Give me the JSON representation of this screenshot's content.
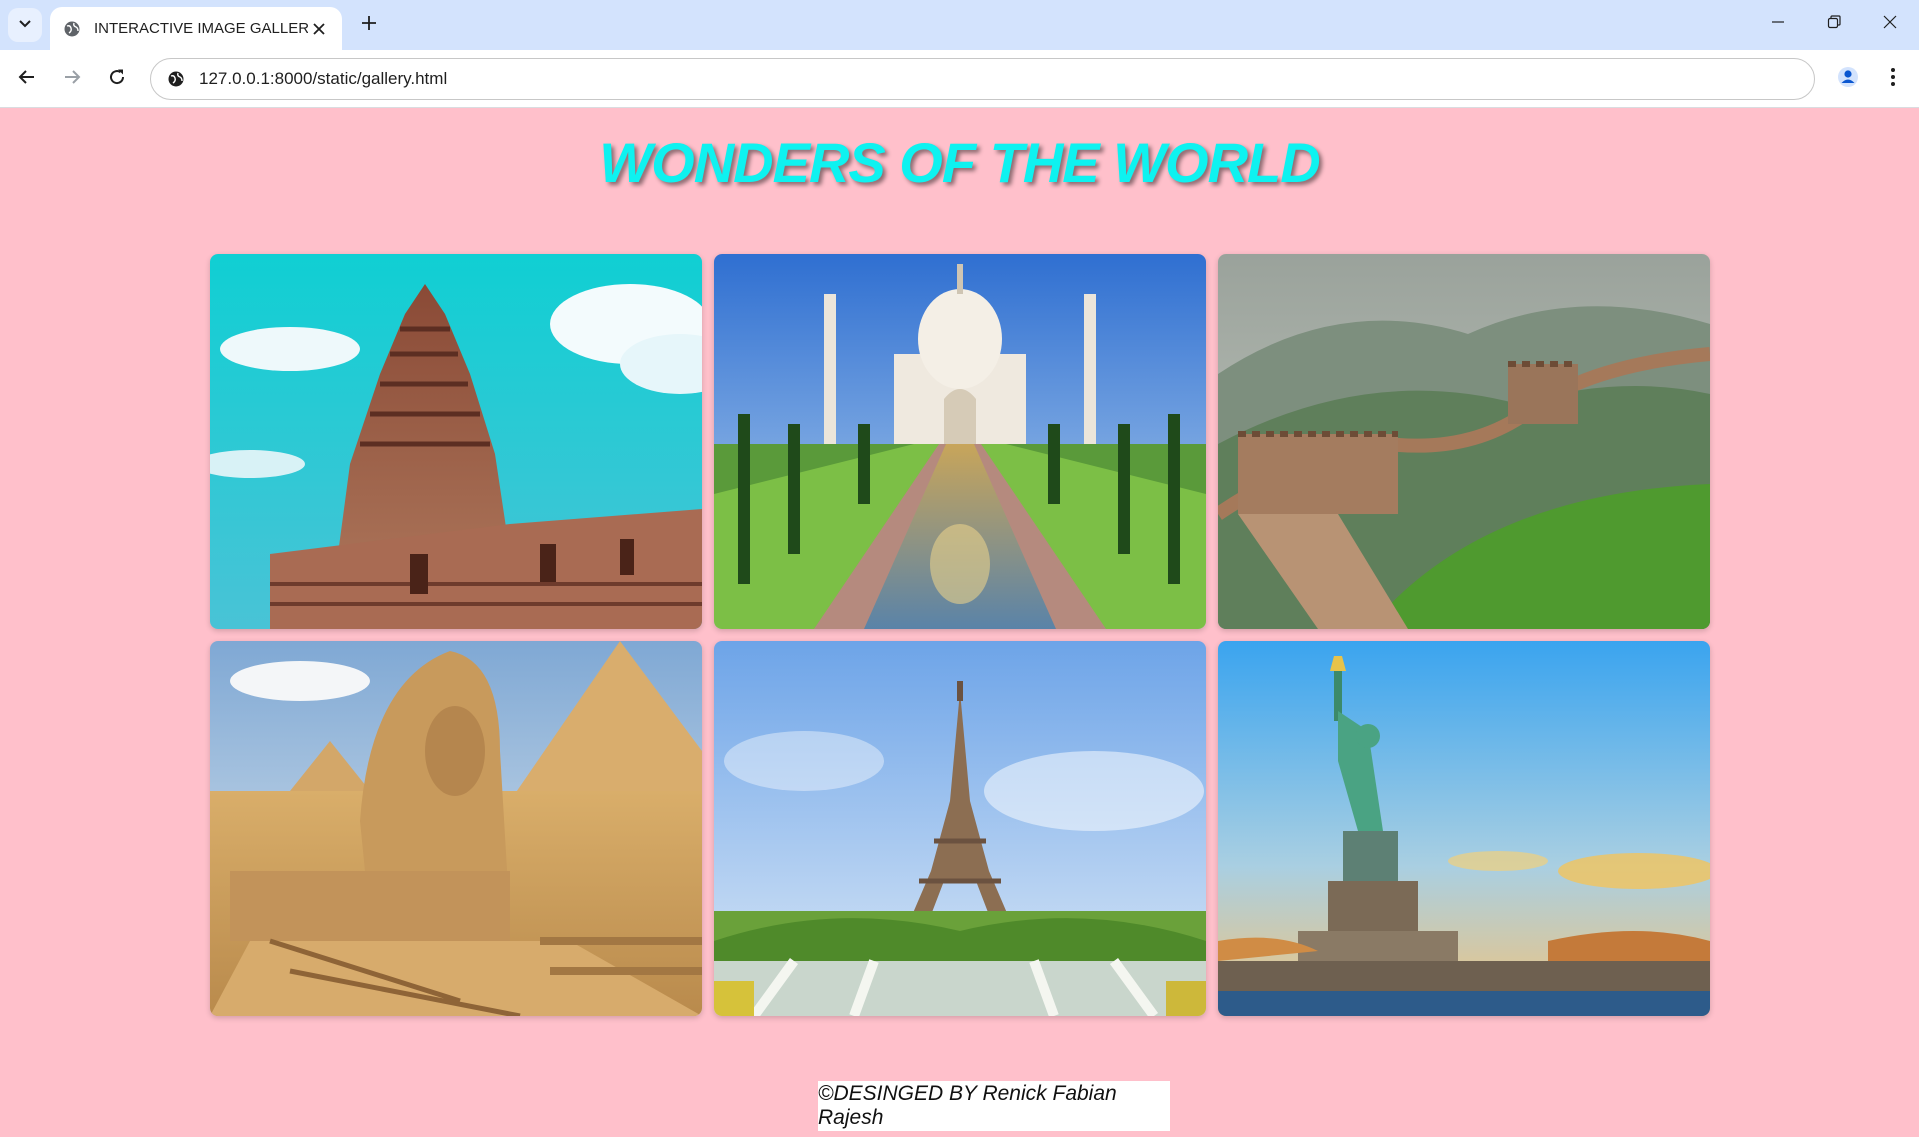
{
  "browser": {
    "tab_title": "INTERACTIVE IMAGE GALLERY",
    "url": "127.0.0.1:8000/static/gallery.html"
  },
  "icons": {
    "tab_list": "chevron-down-icon",
    "favicon": "globe-icon",
    "tab_close": "close-icon",
    "new_tab": "plus-icon",
    "minimize": "minimize-icon",
    "restore": "restore-icon",
    "close_window": "close-icon",
    "back": "arrow-left-icon",
    "forward": "arrow-right-icon",
    "reload": "reload-icon",
    "site_info": "site-info-icon",
    "profile": "person-icon",
    "menu": "more-vert-icon"
  },
  "page": {
    "title": "WONDERS OF THE WORLD",
    "title_color": "#0ef2f0",
    "background": "#ffc0cb",
    "footer": "©DESINGED BY Renick Fabian Rajesh"
  },
  "gallery": [
    {
      "subject": "Brihadeeswarar Temple"
    },
    {
      "subject": "Taj Mahal"
    },
    {
      "subject": "Great Wall of China"
    },
    {
      "subject": "Great Sphinx and Pyramids of Giza"
    },
    {
      "subject": "Eiffel Tower"
    },
    {
      "subject": "Statue of Liberty"
    }
  ]
}
